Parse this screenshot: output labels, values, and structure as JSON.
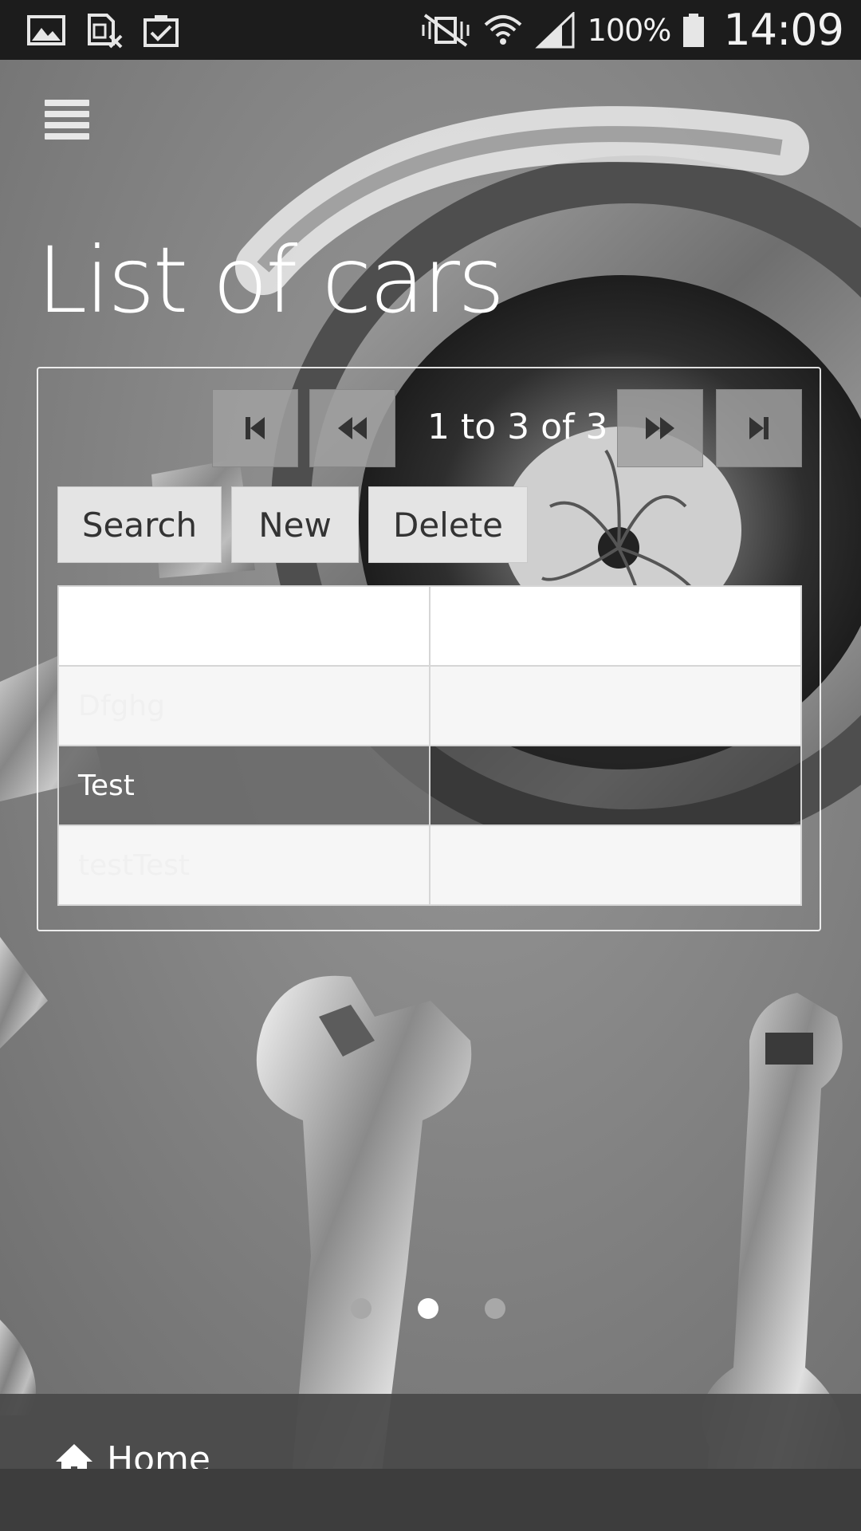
{
  "status_bar": {
    "battery_percent": "100%",
    "time": "14:09",
    "icons": [
      "gallery-icon",
      "sim-error-icon",
      "task-check-icon",
      "vibrate-silent-icon",
      "wifi-icon",
      "signal-icon",
      "battery-icon"
    ]
  },
  "header": {
    "menu_icon": "hamburger-menu-icon",
    "title": "List of cars"
  },
  "pager": {
    "info": "1 to 3 of 3",
    "buttons": [
      "first-page-icon",
      "previous-page-icon",
      "next-page-icon",
      "last-page-icon"
    ]
  },
  "actions": {
    "search_label": "Search",
    "new_label": "New",
    "delete_label": "Delete"
  },
  "table": {
    "rows": [
      {
        "c1": "",
        "c2": ""
      },
      {
        "c1": "Dfghg",
        "c2": ""
      },
      {
        "c1": "Test",
        "c2": ""
      },
      {
        "c1": "testTest",
        "c2": ""
      }
    ]
  },
  "carousel": {
    "count": 3,
    "active_index": 1
  },
  "footer": {
    "home_icon": "home-icon",
    "home_label": "Home"
  },
  "colors": {
    "status_bar": "#1c1c1c",
    "footer_bar": "#4a4a4a",
    "button_bg": "#e4e4e4"
  }
}
